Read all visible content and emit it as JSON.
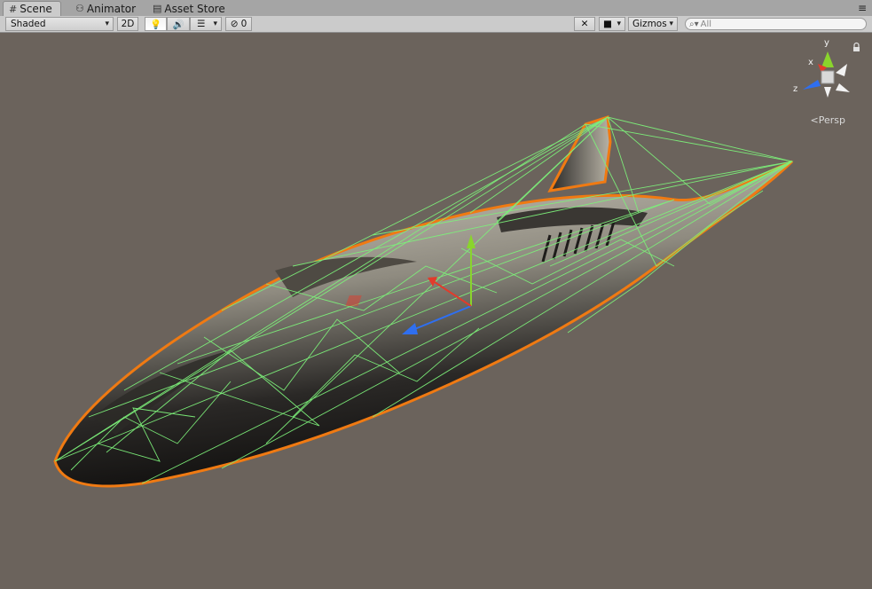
{
  "tabs": [
    {
      "label": "Scene",
      "icon": "grid-icon",
      "active": true
    },
    {
      "label": "Animator",
      "icon": "animator-icon",
      "active": false
    },
    {
      "label": "Asset Store",
      "icon": "store-icon",
      "active": false
    }
  ],
  "toolbar": {
    "draw_mode": "Shaded",
    "mode_2d": "2D",
    "hidden_count": "0",
    "gizmos": "Gizmos",
    "search_placeholder": "All"
  },
  "scene_gizmo": {
    "x_label": "x",
    "y_label": "y",
    "z_label": "z",
    "projection": "Persp"
  },
  "colors": {
    "viewport_bg": "#6b635c",
    "selection_outline": "#f07a12",
    "wireframe": "#7df07a",
    "axis_x": "#e23b2b",
    "axis_y": "#8ad42c",
    "axis_z": "#2f6ff0"
  }
}
